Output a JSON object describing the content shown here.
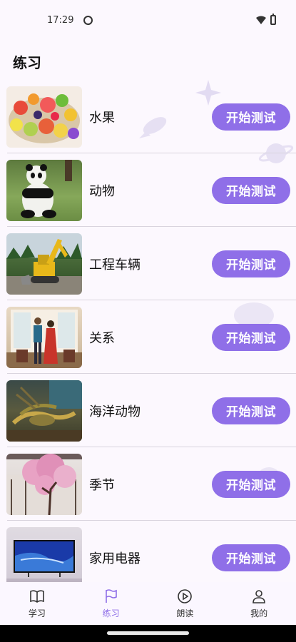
{
  "status": {
    "time": "17:29"
  },
  "header": {
    "title": "练习"
  },
  "practice_items": [
    {
      "label": "水果",
      "button": "开始测试",
      "thumb": "fruit-thumbnail"
    },
    {
      "label": "动物",
      "button": "开始测试",
      "thumb": "panda-thumbnail"
    },
    {
      "label": "工程车辆",
      "button": "开始测试",
      "thumb": "excavator-thumbnail"
    },
    {
      "label": "关系",
      "button": "开始测试",
      "thumb": "couple-thumbnail"
    },
    {
      "label": "海洋动物",
      "button": "开始测试",
      "thumb": "lobster-thumbnail"
    },
    {
      "label": "季节",
      "button": "开始测试",
      "thumb": "cherry-blossom-thumbnail"
    },
    {
      "label": "家用电器",
      "button": "开始测试",
      "thumb": "television-thumbnail"
    }
  ],
  "tabs": [
    {
      "label": "学习",
      "icon": "book-icon",
      "active": false
    },
    {
      "label": "练习",
      "icon": "flag-icon",
      "active": true
    },
    {
      "label": "朗读",
      "icon": "play-circle-icon",
      "active": false
    },
    {
      "label": "我的",
      "icon": "person-icon",
      "active": false
    }
  ],
  "colors": {
    "accent": "#8f6fe8",
    "background": "#fcf8fe",
    "divider": "#d9d4de"
  }
}
